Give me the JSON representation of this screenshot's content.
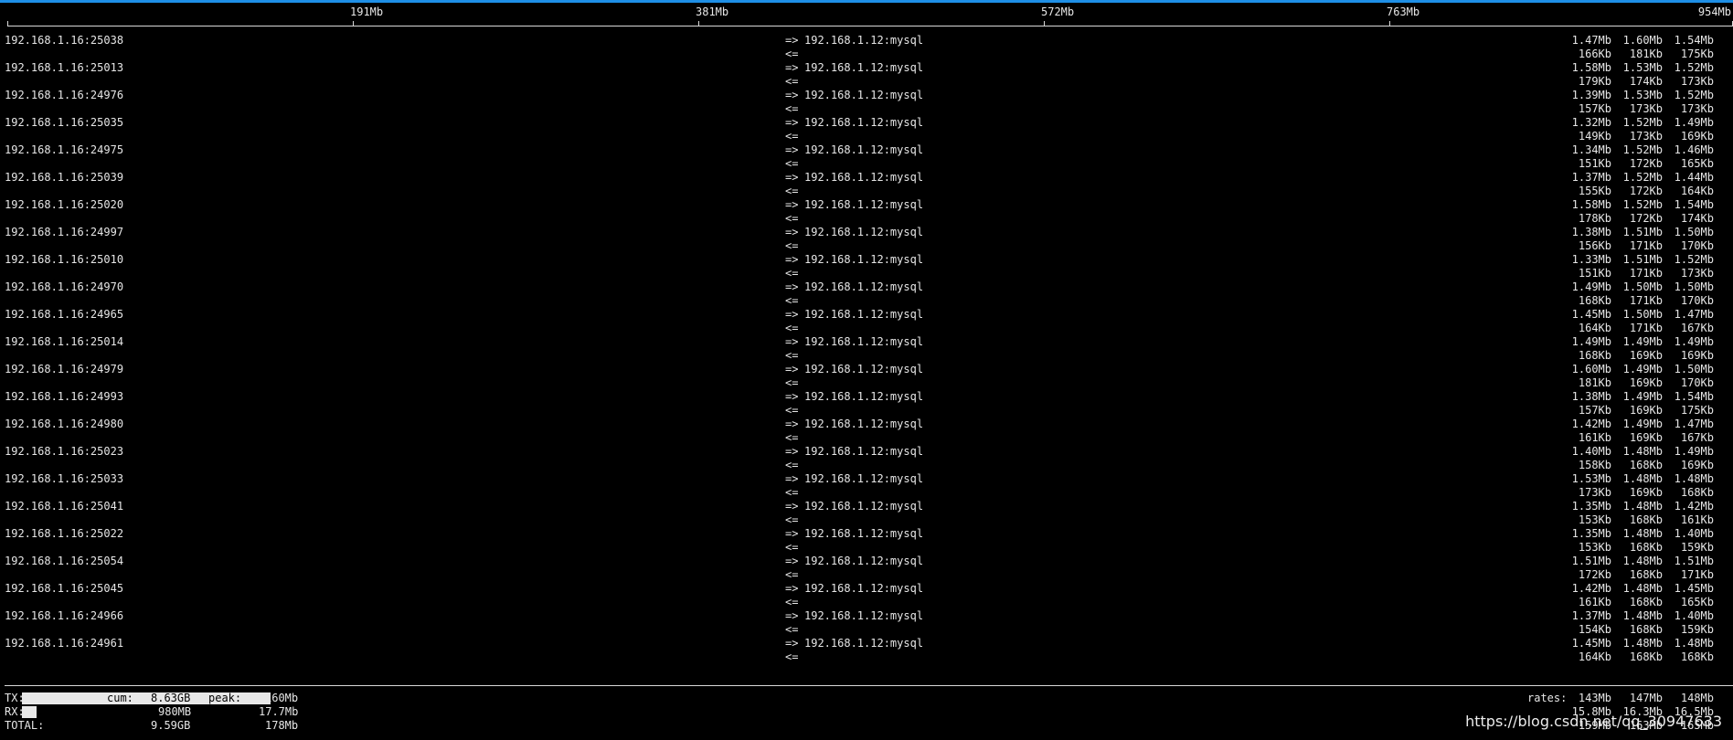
{
  "scale": {
    "ticks": [
      "191Mb",
      "381Mb",
      "572Mb",
      "763Mb",
      "954Mb"
    ]
  },
  "flows": [
    {
      "src": "192.168.1.16:25038",
      "out_arrow": "=>",
      "dst": "192.168.1.12:mysql",
      "in_arrow": "<=",
      "out": [
        "1.47Mb",
        "1.60Mb",
        "1.54Mb"
      ],
      "in": [
        "166Kb",
        "181Kb",
        "175Kb"
      ]
    },
    {
      "src": "192.168.1.16:25013",
      "out_arrow": "=>",
      "dst": "192.168.1.12:mysql",
      "in_arrow": "<=",
      "out": [
        "1.58Mb",
        "1.53Mb",
        "1.52Mb"
      ],
      "in": [
        "179Kb",
        "174Kb",
        "173Kb"
      ]
    },
    {
      "src": "192.168.1.16:24976",
      "out_arrow": "=>",
      "dst": "192.168.1.12:mysql",
      "in_arrow": "<=",
      "out": [
        "1.39Mb",
        "1.53Mb",
        "1.52Mb"
      ],
      "in": [
        "157Kb",
        "173Kb",
        "173Kb"
      ]
    },
    {
      "src": "192.168.1.16:25035",
      "out_arrow": "=>",
      "dst": "192.168.1.12:mysql",
      "in_arrow": "<=",
      "out": [
        "1.32Mb",
        "1.52Mb",
        "1.49Mb"
      ],
      "in": [
        "149Kb",
        "173Kb",
        "169Kb"
      ]
    },
    {
      "src": "192.168.1.16:24975",
      "out_arrow": "=>",
      "dst": "192.168.1.12:mysql",
      "in_arrow": "<=",
      "out": [
        "1.34Mb",
        "1.52Mb",
        "1.46Mb"
      ],
      "in": [
        "151Kb",
        "172Kb",
        "165Kb"
      ]
    },
    {
      "src": "192.168.1.16:25039",
      "out_arrow": "=>",
      "dst": "192.168.1.12:mysql",
      "in_arrow": "<=",
      "out": [
        "1.37Mb",
        "1.52Mb",
        "1.44Mb"
      ],
      "in": [
        "155Kb",
        "172Kb",
        "164Kb"
      ]
    },
    {
      "src": "192.168.1.16:25020",
      "out_arrow": "=>",
      "dst": "192.168.1.12:mysql",
      "in_arrow": "<=",
      "out": [
        "1.58Mb",
        "1.52Mb",
        "1.54Mb"
      ],
      "in": [
        "178Kb",
        "172Kb",
        "174Kb"
      ]
    },
    {
      "src": "192.168.1.16:24997",
      "out_arrow": "=>",
      "dst": "192.168.1.12:mysql",
      "in_arrow": "<=",
      "out": [
        "1.38Mb",
        "1.51Mb",
        "1.50Mb"
      ],
      "in": [
        "156Kb",
        "171Kb",
        "170Kb"
      ]
    },
    {
      "src": "192.168.1.16:25010",
      "out_arrow": "=>",
      "dst": "192.168.1.12:mysql",
      "in_arrow": "<=",
      "out": [
        "1.33Mb",
        "1.51Mb",
        "1.52Mb"
      ],
      "in": [
        "151Kb",
        "171Kb",
        "173Kb"
      ]
    },
    {
      "src": "192.168.1.16:24970",
      "out_arrow": "=>",
      "dst": "192.168.1.12:mysql",
      "in_arrow": "<=",
      "out": [
        "1.49Mb",
        "1.50Mb",
        "1.50Mb"
      ],
      "in": [
        "168Kb",
        "171Kb",
        "170Kb"
      ]
    },
    {
      "src": "192.168.1.16:24965",
      "out_arrow": "=>",
      "dst": "192.168.1.12:mysql",
      "in_arrow": "<=",
      "out": [
        "1.45Mb",
        "1.50Mb",
        "1.47Mb"
      ],
      "in": [
        "164Kb",
        "171Kb",
        "167Kb"
      ]
    },
    {
      "src": "192.168.1.16:25014",
      "out_arrow": "=>",
      "dst": "192.168.1.12:mysql",
      "in_arrow": "<=",
      "out": [
        "1.49Mb",
        "1.49Mb",
        "1.49Mb"
      ],
      "in": [
        "168Kb",
        "169Kb",
        "169Kb"
      ]
    },
    {
      "src": "192.168.1.16:24979",
      "out_arrow": "=>",
      "dst": "192.168.1.12:mysql",
      "in_arrow": "<=",
      "out": [
        "1.60Mb",
        "1.49Mb",
        "1.50Mb"
      ],
      "in": [
        "181Kb",
        "169Kb",
        "170Kb"
      ]
    },
    {
      "src": "192.168.1.16:24993",
      "out_arrow": "=>",
      "dst": "192.168.1.12:mysql",
      "in_arrow": "<=",
      "out": [
        "1.38Mb",
        "1.49Mb",
        "1.54Mb"
      ],
      "in": [
        "157Kb",
        "169Kb",
        "175Kb"
      ]
    },
    {
      "src": "192.168.1.16:24980",
      "out_arrow": "=>",
      "dst": "192.168.1.12:mysql",
      "in_arrow": "<=",
      "out": [
        "1.42Mb",
        "1.49Mb",
        "1.47Mb"
      ],
      "in": [
        "161Kb",
        "169Kb",
        "167Kb"
      ]
    },
    {
      "src": "192.168.1.16:25023",
      "out_arrow": "=>",
      "dst": "192.168.1.12:mysql",
      "in_arrow": "<=",
      "out": [
        "1.40Mb",
        "1.48Mb",
        "1.49Mb"
      ],
      "in": [
        "158Kb",
        "168Kb",
        "169Kb"
      ]
    },
    {
      "src": "192.168.1.16:25033",
      "out_arrow": "=>",
      "dst": "192.168.1.12:mysql",
      "in_arrow": "<=",
      "out": [
        "1.53Mb",
        "1.48Mb",
        "1.48Mb"
      ],
      "in": [
        "173Kb",
        "169Kb",
        "168Kb"
      ]
    },
    {
      "src": "192.168.1.16:25041",
      "out_arrow": "=>",
      "dst": "192.168.1.12:mysql",
      "in_arrow": "<=",
      "out": [
        "1.35Mb",
        "1.48Mb",
        "1.42Mb"
      ],
      "in": [
        "153Kb",
        "168Kb",
        "161Kb"
      ]
    },
    {
      "src": "192.168.1.16:25022",
      "out_arrow": "=>",
      "dst": "192.168.1.12:mysql",
      "in_arrow": "<=",
      "out": [
        "1.35Mb",
        "1.48Mb",
        "1.40Mb"
      ],
      "in": [
        "153Kb",
        "168Kb",
        "159Kb"
      ]
    },
    {
      "src": "192.168.1.16:25054",
      "out_arrow": "=>",
      "dst": "192.168.1.12:mysql",
      "in_arrow": "<=",
      "out": [
        "1.51Mb",
        "1.48Mb",
        "1.51Mb"
      ],
      "in": [
        "172Kb",
        "168Kb",
        "171Kb"
      ]
    },
    {
      "src": "192.168.1.16:25045",
      "out_arrow": "=>",
      "dst": "192.168.1.12:mysql",
      "in_arrow": "<=",
      "out": [
        "1.42Mb",
        "1.48Mb",
        "1.45Mb"
      ],
      "in": [
        "161Kb",
        "168Kb",
        "165Kb"
      ]
    },
    {
      "src": "192.168.1.16:24966",
      "out_arrow": "=>",
      "dst": "192.168.1.12:mysql",
      "in_arrow": "<=",
      "out": [
        "1.37Mb",
        "1.48Mb",
        "1.40Mb"
      ],
      "in": [
        "154Kb",
        "168Kb",
        "159Kb"
      ]
    },
    {
      "src": "192.168.1.16:24961",
      "out_arrow": "=>",
      "dst": "192.168.1.12:mysql",
      "in_arrow": "<=",
      "out": [
        "1.45Mb",
        "1.48Mb",
        "1.48Mb"
      ],
      "in": [
        "164Kb",
        "168Kb",
        "168Kb"
      ]
    }
  ],
  "totals": {
    "tx": {
      "label": "TX:",
      "cum_label": "cum:",
      "cum": "8.63GB",
      "peak_label": "peak:",
      "peak": "160Mb",
      "rates": [
        "143Mb",
        "147Mb",
        "148Mb"
      ]
    },
    "rx": {
      "label": "RX:",
      "cum": "980MB",
      "peak": "17.7Mb",
      "rates": [
        "15.8Mb",
        "16.3Mb",
        "16.5Mb"
      ]
    },
    "total": {
      "label": "TOTAL:",
      "cum": "9.59GB",
      "peak": "178Mb",
      "rates": [
        "159Mb",
        "163Mb",
        "165Mb"
      ]
    },
    "rates_label": "rates:"
  },
  "watermark": "https://blog.csdn.net/qq_30947633"
}
